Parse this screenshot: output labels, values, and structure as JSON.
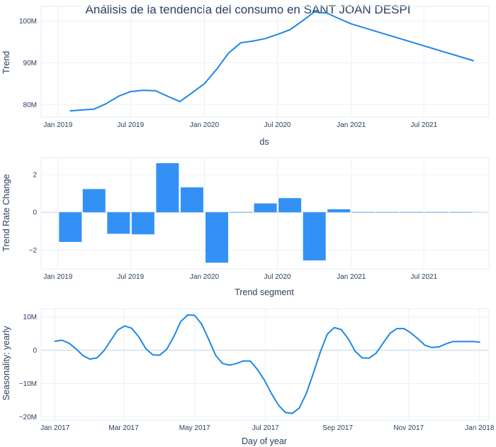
{
  "chart_data": [
    {
      "type": "line",
      "title": "Análisis de la tendencia del consumo en SANT JOAN DESPI",
      "xlabel": "ds",
      "ylabel": "Trend",
      "color": "#1e88e5",
      "xlim": [
        "2018-11-20",
        "2021-12-10"
      ],
      "ylim": [
        77000000,
        103500000
      ],
      "x_ticks": [
        {
          "value": "2019-01-01",
          "label": "Jan 2019"
        },
        {
          "value": "2019-07-01",
          "label": "Jul 2019"
        },
        {
          "value": "2020-01-01",
          "label": "Jan 2020"
        },
        {
          "value": "2020-07-01",
          "label": "Jul 2020"
        },
        {
          "value": "2021-01-01",
          "label": "Jan 2021"
        },
        {
          "value": "2021-07-01",
          "label": "Jul 2021"
        }
      ],
      "y_ticks": [
        {
          "value": 80000000,
          "label": "80M"
        },
        {
          "value": 90000000,
          "label": "90M"
        },
        {
          "value": 100000000,
          "label": "100M"
        }
      ],
      "x": [
        "2019-02-01",
        "2019-03-01",
        "2019-04-01",
        "2019-05-01",
        "2019-06-01",
        "2019-07-01",
        "2019-08-01",
        "2019-09-01",
        "2019-10-01",
        "2019-11-01",
        "2019-12-01",
        "2020-01-01",
        "2020-02-01",
        "2020-03-01",
        "2020-04-01",
        "2020-05-01",
        "2020-06-01",
        "2020-07-01",
        "2020-08-01",
        "2020-09-01",
        "2020-10-01",
        "2020-11-01",
        "2020-12-01",
        "2021-01-01",
        "2021-11-01"
      ],
      "y": [
        78500000,
        78700000,
        78900000,
        80200000,
        82000000,
        83100000,
        83400000,
        83300000,
        82000000,
        80700000,
        82800000,
        85000000,
        88500000,
        92300000,
        94800000,
        95200000,
        95800000,
        96800000,
        97900000,
        100000000,
        102200000,
        101900000,
        100600000,
        99300000,
        90500000
      ]
    },
    {
      "type": "bar",
      "xlabel": "Trend segment",
      "ylabel": "Trend Rate Change",
      "color": "#3391f6",
      "xlim": [
        "2018-11-20",
        "2021-12-10"
      ],
      "ylim": [
        -3.0,
        2.9
      ],
      "x_ticks": [
        {
          "value": "2019-01-01",
          "label": "Jan 2019"
        },
        {
          "value": "2019-07-01",
          "label": "Jul 2019"
        },
        {
          "value": "2020-01-01",
          "label": "Jan 2020"
        },
        {
          "value": "2020-07-01",
          "label": "Jul 2020"
        },
        {
          "value": "2021-01-01",
          "label": "Jan 2021"
        },
        {
          "value": "2021-07-01",
          "label": "Jul 2021"
        }
      ],
      "y_ticks": [
        {
          "value": -2,
          "label": "−2"
        },
        {
          "value": 0,
          "label": "0"
        },
        {
          "value": 2,
          "label": "2"
        }
      ],
      "x": [
        "2019-02-01",
        "2019-04-01",
        "2019-06-01",
        "2019-08-01",
        "2019-10-01",
        "2019-12-01",
        "2020-02-01",
        "2020-04-01",
        "2020-06-01",
        "2020-08-01",
        "2020-10-01",
        "2020-12-01",
        "2021-02-01",
        "2021-04-01",
        "2021-06-01",
        "2021-08-01",
        "2021-10-01"
      ],
      "values": [
        -1.57,
        1.23,
        -1.14,
        -1.17,
        2.6,
        1.32,
        -2.67,
        0.0,
        0.47,
        0.75,
        -2.55,
        0.16,
        0.0,
        0.0,
        0.0,
        0.0,
        0.0
      ]
    },
    {
      "type": "line",
      "xlabel": "Day of year",
      "ylabel": "Seasonality: yearly",
      "color": "#1e88e5",
      "xlim": [
        -12,
        373
      ],
      "ylim": [
        -21000000,
        12500000
      ],
      "x_ticks": [
        {
          "value": 0,
          "label": "Jan 2017"
        },
        {
          "value": 59,
          "label": "Mar 2017"
        },
        {
          "value": 120,
          "label": "May 2017"
        },
        {
          "value": 181,
          "label": "Jul 2017"
        },
        {
          "value": 243,
          "label": "Sep 2017"
        },
        {
          "value": 304,
          "label": "Nov 2017"
        },
        {
          "value": 365,
          "label": "Jan 2018"
        }
      ],
      "y_ticks": [
        {
          "value": -20000000,
          "label": "−20M"
        },
        {
          "value": -10000000,
          "label": "−10M"
        },
        {
          "value": 0,
          "label": "0"
        },
        {
          "value": 10000000,
          "label": "10M"
        }
      ],
      "x": [
        0,
        6,
        12,
        18,
        24,
        30,
        36,
        42,
        48,
        54,
        60,
        66,
        72,
        78,
        84,
        90,
        96,
        102,
        108,
        114,
        120,
        126,
        132,
        138,
        144,
        150,
        156,
        162,
        168,
        174,
        180,
        186,
        192,
        198,
        204,
        210,
        216,
        222,
        228,
        234,
        240,
        246,
        252,
        258,
        264,
        270,
        276,
        282,
        288,
        294,
        300,
        306,
        312,
        318,
        324,
        330,
        336,
        342,
        348,
        354,
        360,
        365
      ],
      "y": [
        2700000,
        3000000,
        2100000,
        400000,
        -1600000,
        -2700000,
        -2300000,
        -200000,
        3000000,
        6100000,
        7300000,
        6600000,
        4000000,
        500000,
        -1400000,
        -1500000,
        300000,
        4000000,
        8600000,
        10600000,
        10500000,
        7900000,
        3300000,
        -1500000,
        -4000000,
        -4500000,
        -4000000,
        -3200000,
        -3300000,
        -5800000,
        -9000000,
        -13000000,
        -16500000,
        -18700000,
        -19000000,
        -17400000,
        -13000000,
        -7000000,
        -600000,
        4800000,
        6800000,
        6200000,
        3500000,
        -300000,
        -2300000,
        -2400000,
        -900000,
        2100000,
        5100000,
        6500000,
        6500000,
        5200000,
        3400000,
        1500000,
        800000,
        1000000,
        1900000,
        2600000,
        2600000,
        2600000,
        2600000,
        2400000
      ]
    }
  ]
}
